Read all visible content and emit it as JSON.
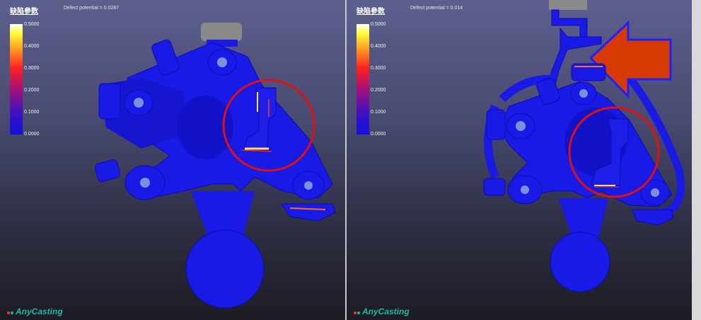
{
  "left_panel": {
    "title": "缺陷參数",
    "defect_text": "Defect potential = 0.0287",
    "legend_ticks": [
      "0.5000",
      "0.4000",
      "0.3000",
      "0.2000",
      "0.1000",
      "0.0000"
    ],
    "logo": "AnyCasting"
  },
  "right_panel": {
    "title": "缺陷參数",
    "defect_text": "Defect potential = 0.014",
    "legend_ticks": [
      "0.5000",
      "0.4000",
      "0.3000",
      "0.2000",
      "0.1000",
      "0.0000"
    ],
    "logo": "AnyCasting"
  },
  "colors": {
    "part": "#1a1ae6",
    "highlight_circle": "#e01010",
    "arrow": "#d63a00",
    "arrow_outline": "#2020ff"
  },
  "icons": {
    "brand": "anycasting-logo"
  }
}
